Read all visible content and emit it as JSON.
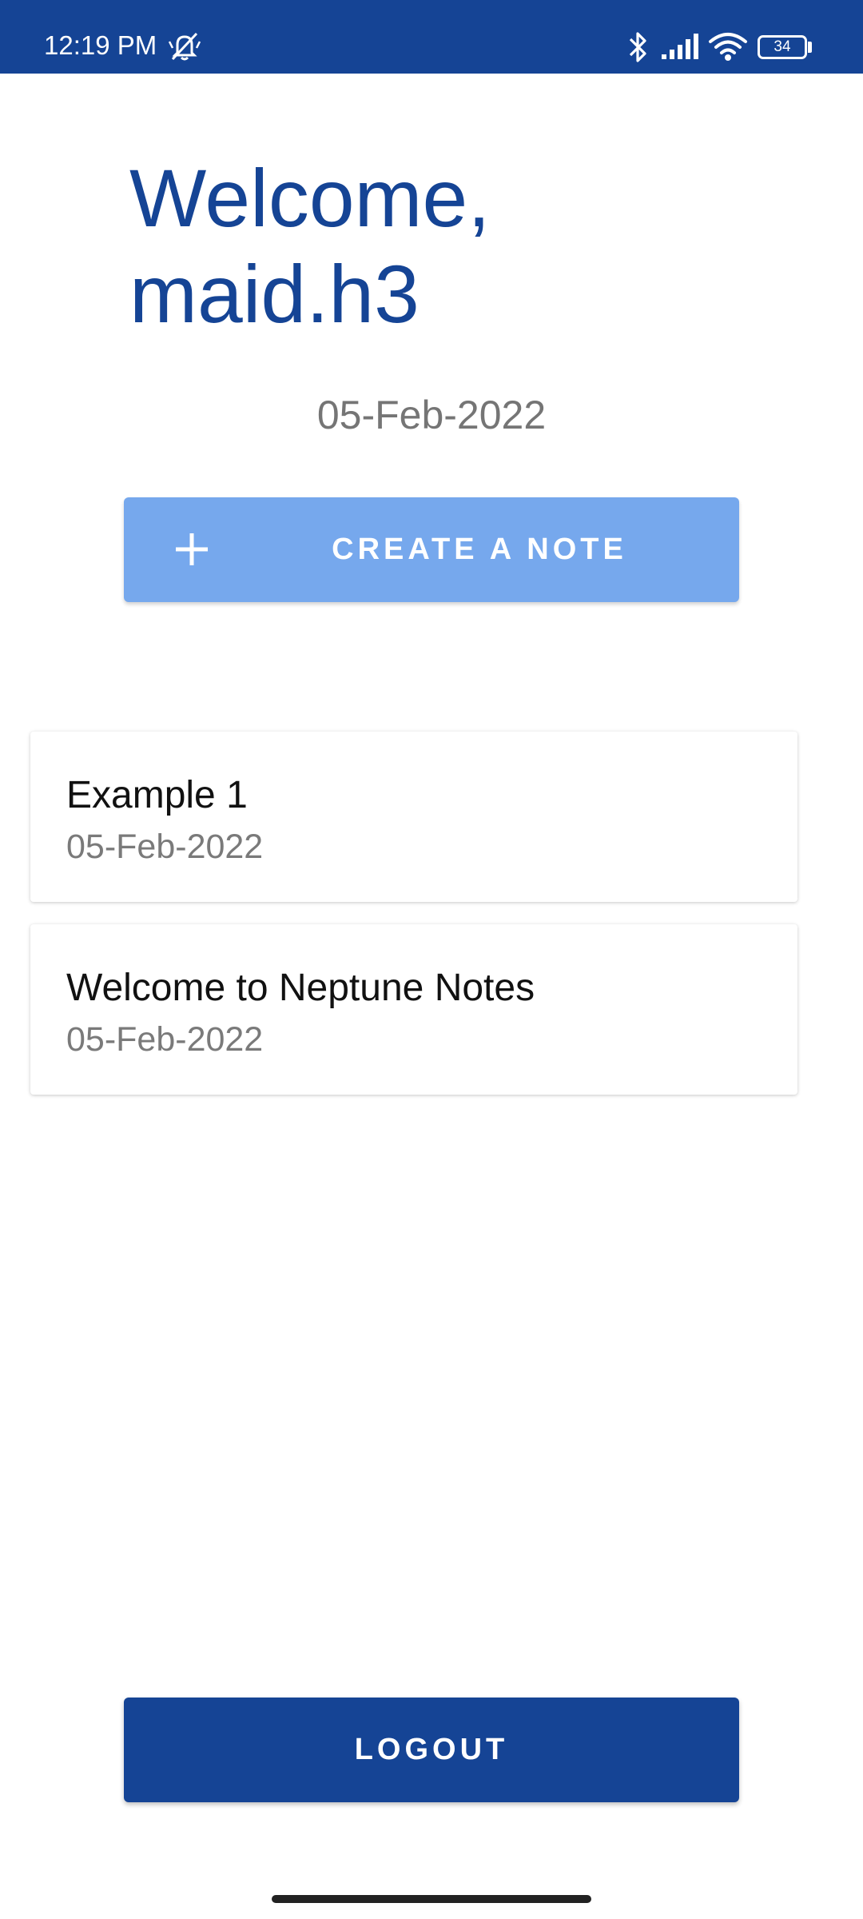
{
  "status_bar": {
    "time": "12:19 PM",
    "battery_level": "34",
    "icons": [
      "alarm-off-icon",
      "bluetooth-icon",
      "signal-icon",
      "wifi-icon",
      "battery-icon"
    ],
    "background_color": "#154495"
  },
  "header": {
    "welcome_line1": "Welcome,",
    "welcome_line2": "maid.h3",
    "date": "05-Feb-2022",
    "title_color": "#154495"
  },
  "create_button": {
    "label": "CREATE A NOTE",
    "icon": "plus-icon",
    "color": "#76a8ed"
  },
  "notes": [
    {
      "title": "Example 1",
      "date": "05-Feb-2022"
    },
    {
      "title": "Welcome to Neptune Notes",
      "date": "05-Feb-2022"
    }
  ],
  "logout_button": {
    "label": "LOGOUT",
    "color": "#154495"
  }
}
